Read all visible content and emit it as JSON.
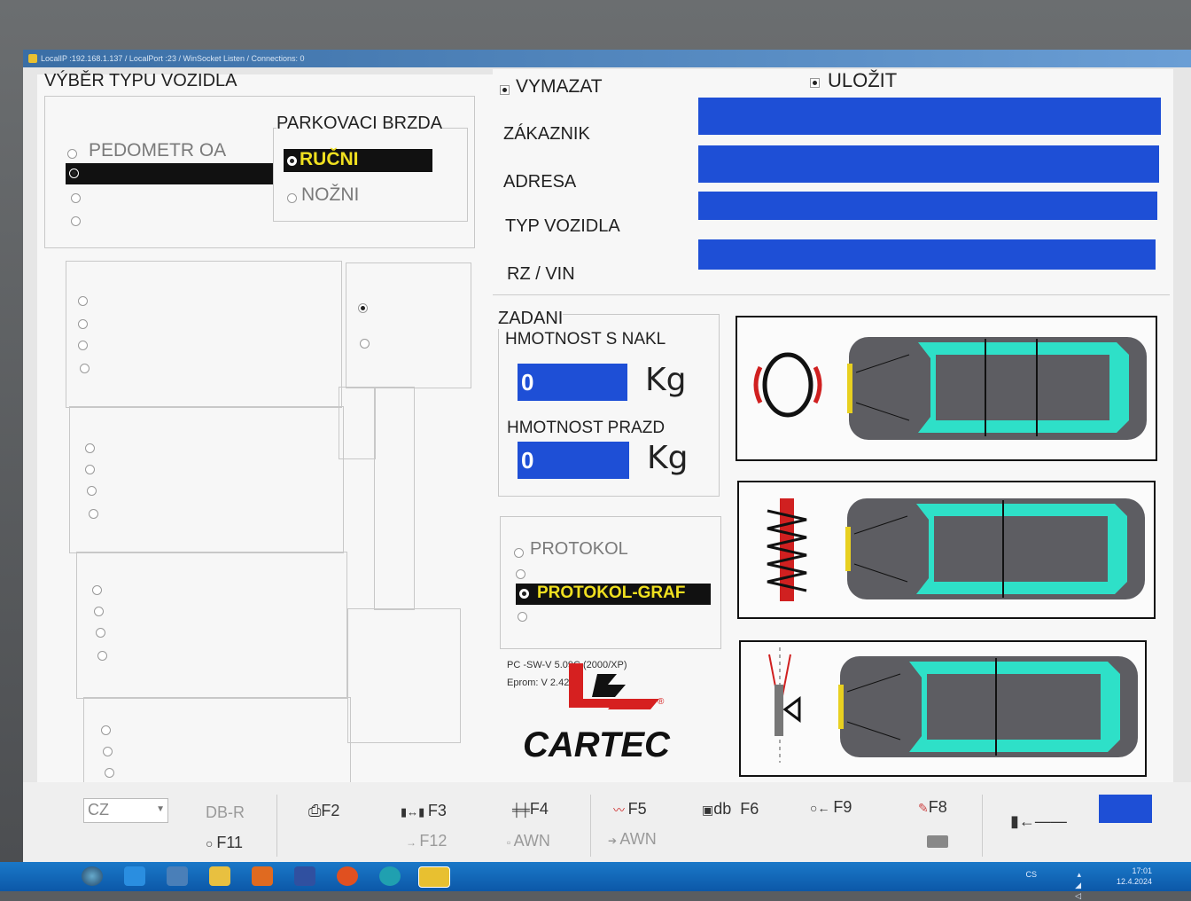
{
  "window": {
    "title": "LocalIP :192.168.1.137 / LocalPort :23 / WinSocket Listen / Connections: 0"
  },
  "left": {
    "section_title": "VÝBĚR TYPU VOZIDLA",
    "pedometr_label": "PEDOMETR OA",
    "brake": {
      "title": "PARKOVACI BRZDA",
      "options": [
        "RUČNI",
        "NOŽNI"
      ],
      "selected": "RUČNI"
    }
  },
  "right": {
    "vymazat_label": "VYMAZAT",
    "ulozit_label": "ULOŽIT",
    "fields": [
      {
        "label": "ZÁKAZNIK",
        "value": ""
      },
      {
        "label": "ADRESA",
        "value": ""
      },
      {
        "label": "TYP VOZIDLA",
        "value": ""
      },
      {
        "label": "RZ / VIN",
        "value": ""
      }
    ],
    "zadani": {
      "title": "ZADANI",
      "mass_loaded_label": "HMOTNOST S NAKL",
      "mass_loaded_value": "0",
      "mass_empty_label": "HMOTNOST PRAZD",
      "mass_empty_value": "0",
      "unit": "Kg"
    },
    "protocol": {
      "options": [
        "PROTOKOL",
        "PROTOKOL-GRAF"
      ],
      "selected": "PROTOKOL-GRAF"
    },
    "version": {
      "sw": "PC -SW-V 5.09C (2000/XP)",
      "eprom": "Eprom: V 2.42"
    },
    "brand": "CARTEC"
  },
  "fkeys": {
    "language": "CZ",
    "row1": [
      "DB-R",
      "F2",
      "F3",
      "F4",
      "F5",
      "db  F6",
      "F9",
      "F8"
    ],
    "row2": [
      "F11",
      "F12",
      "AWN",
      "AWN"
    ]
  },
  "taskbar": {
    "language": "CS",
    "time": "17:01",
    "date": "12.4.2024"
  },
  "colors": {
    "field_blue": "#1e4fd6",
    "car_cyan": "#2ee0c8",
    "selection_yellow": "#f0e020"
  }
}
